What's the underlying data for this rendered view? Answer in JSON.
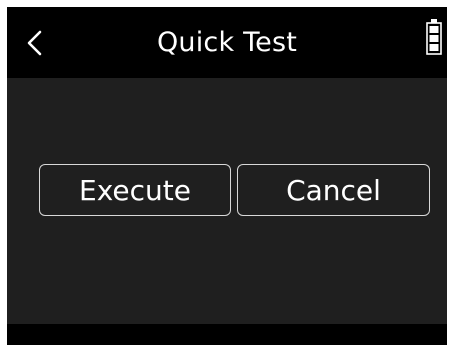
{
  "header": {
    "title": "Quick Test",
    "back_icon": "chevron-left-icon",
    "battery_icon": "battery-full-icon"
  },
  "dialog": {
    "execute_label": "Execute",
    "cancel_label": "Cancel"
  },
  "colors": {
    "header_bg": "#000000",
    "screen_bg": "#1f1f1f",
    "text": "#ffffff",
    "button_border": "#d8d8d8"
  }
}
